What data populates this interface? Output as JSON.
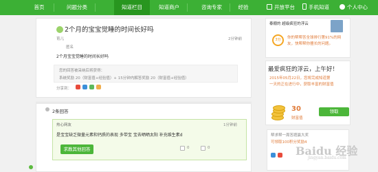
{
  "nav": {
    "home": "首页",
    "category": "问题分类",
    "column": "知道栏目",
    "merchant": "知道商户",
    "expert": "咨询专家",
    "experience": "经验",
    "open_platform": "开放平台",
    "mobile": "手机知道",
    "personal": "个人中心"
  },
  "question": {
    "title": "2个月的宝宝觉睡的时间长好吗",
    "meta_left": "育儿",
    "meta_time": "2分钟前",
    "asker": "匿名",
    "detail": "2个月宝宝觉睡的时间长好吗",
    "reply_hint": "您的回答被采纳后将获得：",
    "reward_line": "系统奖励 20（财富值+经验值）+ 15分钟内解答奖励 20（财富值+经验值）",
    "share_label": "分享到："
  },
  "answers": {
    "count_label": "2条回答",
    "answer_time": "1分钟前",
    "user": "热心网友",
    "text": "是宝宝缺乏微量元素和钙质的表现 多带宝 宝去晒晒太阳 补充维生素d",
    "help_label": "求教其他回答",
    "vote_up": "0",
    "vote_down": "0"
  },
  "sidebar": {
    "user_title": "泰顺的 超级疯狂的浮云",
    "user_desc1": "你的帮帮答全球排行第91%的网",
    "user_desc2": "友，快帮帮你擅长的问题。",
    "level": "3分",
    "greeting": "最爱疯狂的浮云，上午好！",
    "date_line": "2015年05月22日，您将完成知道第",
    "task_line": "一天的正在进行中，获取丰富的财富值",
    "reward_value": "30",
    "reward_unit": "财富值",
    "claim_button": "领取",
    "ad_line1": "帮求帮一周答题赢大奖",
    "ad_line2": "可领取100积分奖励4"
  },
  "watermark": {
    "brand": "Baidu 经验",
    "url": "jingyan.baidu.com"
  },
  "colors": {
    "brand_green": "#3cb035",
    "accent_orange": "#f08c00",
    "link_red": "#e53030"
  }
}
